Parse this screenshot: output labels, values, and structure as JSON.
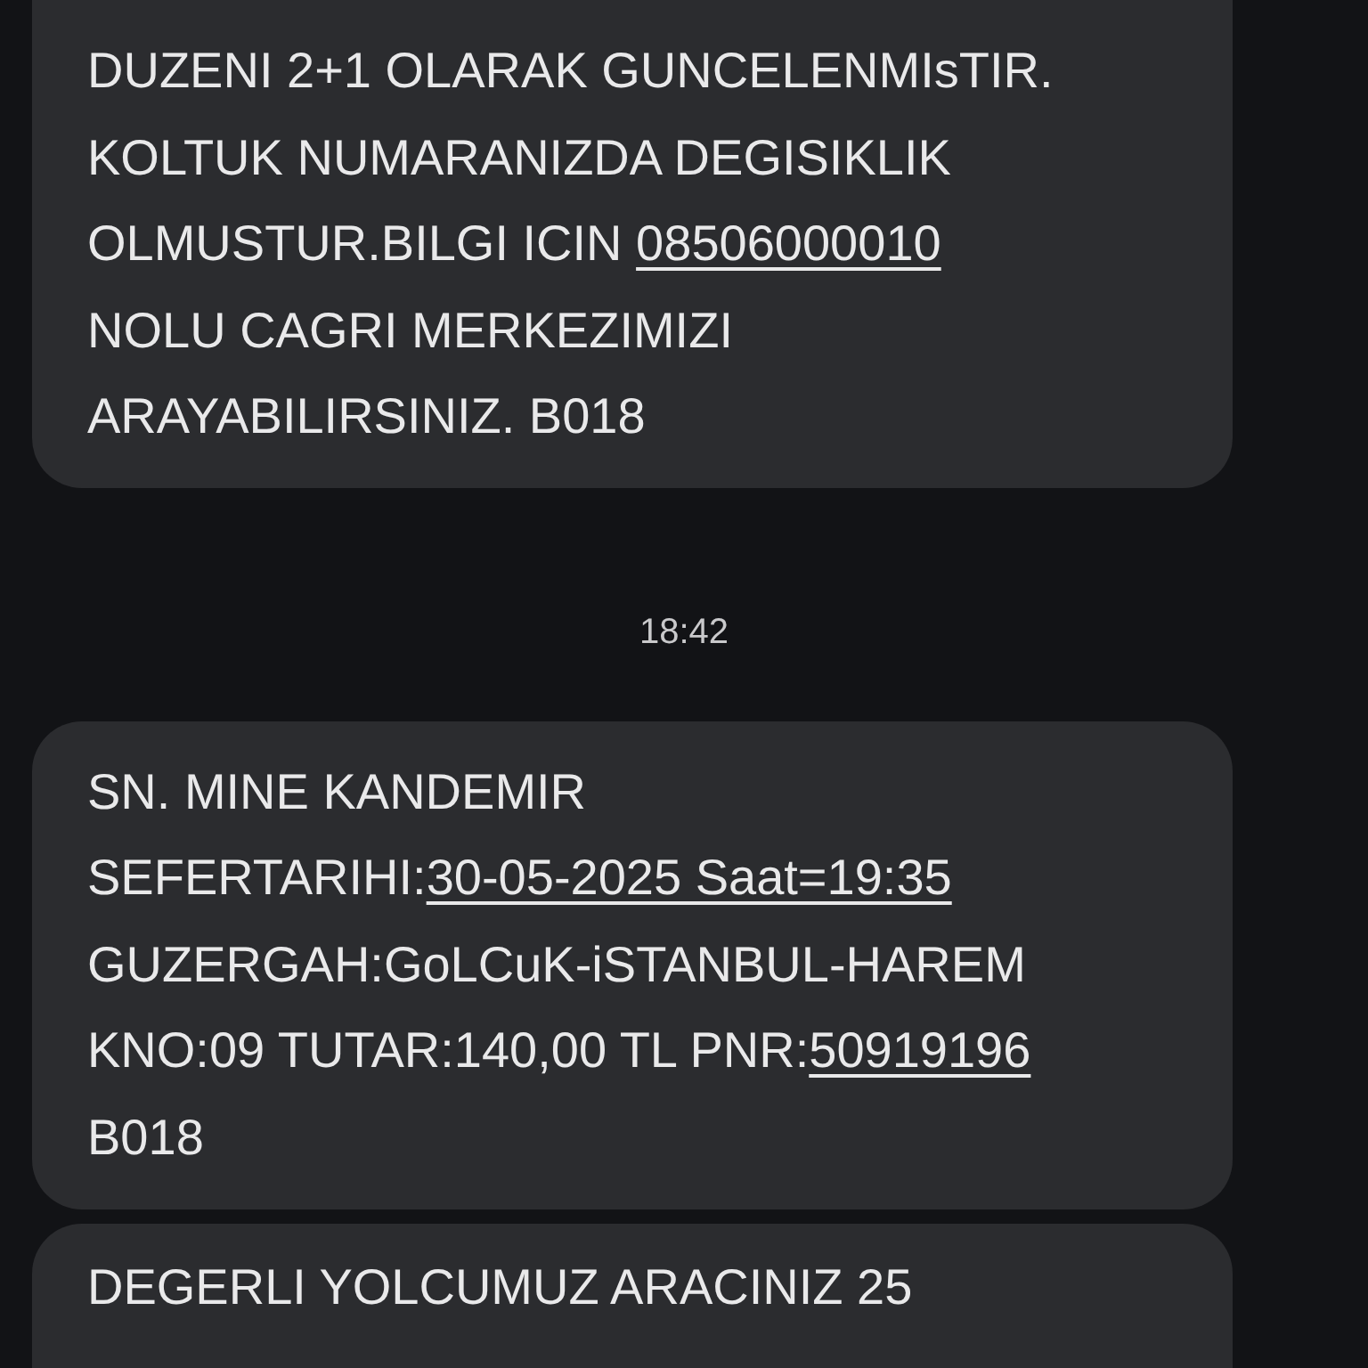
{
  "messages": [
    {
      "kind": "bubble",
      "lines": [
        [
          {
            "text": "DUZENI 2+1 OLARAK GUNCELENMIsTIR.",
            "link": false
          }
        ],
        [
          {
            "text": "KOLTUK NUMARANIZDA DEGISIKLIK",
            "link": false
          }
        ],
        [
          {
            "text": "OLMUSTUR.BILGI ICIN ",
            "link": false
          },
          {
            "text": "08506000010",
            "link": true
          }
        ],
        [
          {
            "text": "NOLU CAGRI MERKEZIMIZI",
            "link": false
          }
        ],
        [
          {
            "text": "ARAYABILIRSINIZ. B018",
            "link": false
          }
        ]
      ]
    },
    {
      "kind": "time",
      "text": "18:42"
    },
    {
      "kind": "bubble",
      "lines": [
        [
          {
            "text": "SN. MINE KANDEMIR",
            "link": false
          }
        ],
        [
          {
            "text": "SEFERTARIHI:",
            "link": false
          },
          {
            "text": "30-05-2025 Saat=19:35",
            "link": true
          }
        ],
        [
          {
            "text": "GUZERGAH:GoLCuK-iSTANBUL-HAREM",
            "link": false
          }
        ],
        [
          {
            "text": "KNO:09 TUTAR:140,00 TL PNR:",
            "link": false
          },
          {
            "text": "50919196",
            "link": true
          }
        ],
        [
          {
            "text": "B018",
            "link": false
          }
        ]
      ]
    },
    {
      "kind": "bubble",
      "lines": [
        [
          {
            "text": "DEGERLI YOLCUMUZ ARACINIZ 25",
            "link": false
          }
        ]
      ]
    }
  ]
}
